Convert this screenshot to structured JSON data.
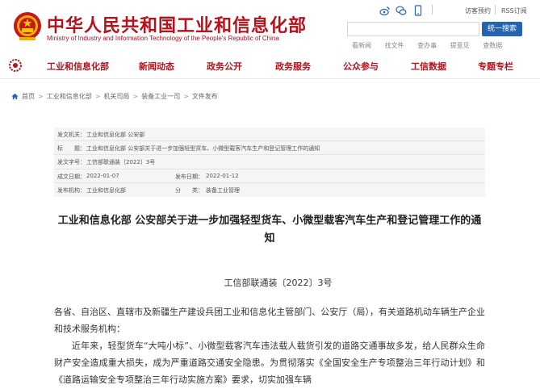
{
  "header": {
    "title": "中华人民共和国工业和信息化部",
    "subtitle": "Ministry of Industry and Information Technology of the People's Republic of China",
    "top_links": [
      "访客预约",
      "RSS订阅"
    ],
    "search_placeholder": "",
    "search_button": "统一搜索",
    "quick_links": [
      "看新闻",
      "找文件",
      "查办事",
      "提意见",
      "查数据"
    ]
  },
  "nav": {
    "items": [
      "工业和信息化部",
      "新闻动态",
      "政务公开",
      "政务服务",
      "公众参与",
      "工信数据",
      "专题专栏"
    ]
  },
  "breadcrumb": [
    "首页",
    "工业和信息化部",
    "机关司局",
    "装备工业一司",
    "文件发布"
  ],
  "info": {
    "issuer_label": "发文机关：",
    "issuer_value": "工业和信息化部 公安部",
    "title_label": "标　　题：",
    "title_value": "工业和信息化部 公安部关于进一步加强轻型货车、小微型载客汽车生产和登记管理工作的通知",
    "docno_label": "发文字号：",
    "docno_value": "工信部联通装〔2022〕3号",
    "created_label": "成文日期：",
    "created_value": "2022-01-07",
    "published_label": "发布日期：",
    "published_value": "2022-01-12",
    "agency_label": "发布机构：",
    "agency_value": "工业和信息化部",
    "category_label": "分　　类：",
    "category_value": "装备工业管理"
  },
  "article": {
    "title": "工业和信息化部 公安部关于进一步加强轻型货车、小微型载客汽车生产和登记管理工作的通知",
    "doc_number": "工信部联通装〔2022〕3号",
    "salutation": "各省、自治区、直辖市及新疆生产建设兵团工业和信息化主管部门、公安厅（局），有关道路机动车辆生产企业和技术服务机构：",
    "paragraph1": "近年来，轻型货车“大吨小标”、小微型载客汽车违法载人载货引发的道路交通事故多发，给人民群众生命财产安全造成重大损失，成为严重道路交通安全隐患。为贯彻落实《全国安全生产专项整治三年行动计划》和《道路运输安全专项整治三年行动实施方案》要求，切实加强车辆"
  },
  "colors": {
    "brand_red": "#b5121b",
    "search_blue": "#2563b0",
    "info_bg": "#f5f5f5"
  }
}
